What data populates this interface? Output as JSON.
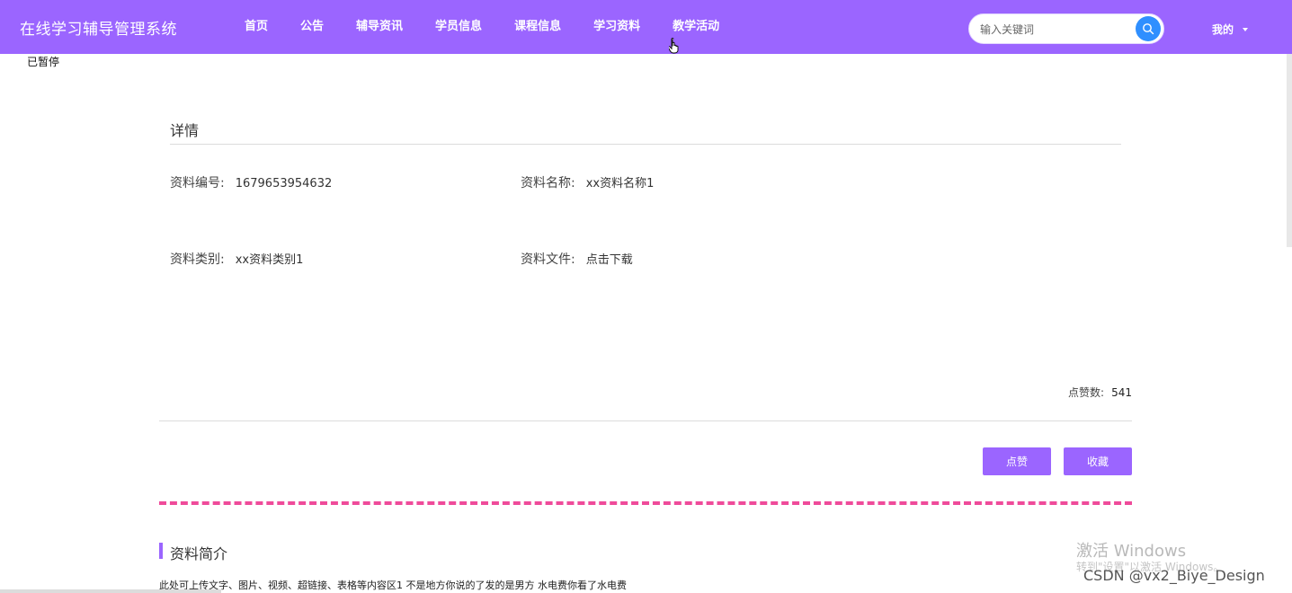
{
  "header": {
    "brand": "在线学习辅导管理系统",
    "nav": [
      "首页",
      "公告",
      "辅导资讯",
      "学员信息",
      "课程信息",
      "学习资料",
      "教学活动"
    ],
    "search_placeholder": "输入关键词",
    "user_menu": "我的"
  },
  "status": {
    "paused": "已暂停"
  },
  "detail": {
    "section_title": "详情",
    "fields": [
      {
        "label": "资料编号:",
        "value": "1679653954632"
      },
      {
        "label": "资料名称:",
        "value": "xx资料名称1"
      },
      {
        "label": "资料类别:",
        "value": "xx资料类别1"
      },
      {
        "label": "资料文件:",
        "value": "点击下载"
      }
    ],
    "likes_label": "点赞数:",
    "likes_value": "541",
    "like_button": "点赞",
    "favorite_button": "收藏"
  },
  "intro": {
    "title": "资料简介",
    "text": "此处可上传文字、图片、视频、超链接、表格等内容区1 不是地方你说的了发的是男方 水电费你看了水电费"
  },
  "watermark": {
    "line1": "激活 Windows",
    "line2": "转到\"设置\"以激活 Windows。",
    "credit": "CSDN @vx2_Biye_Design"
  },
  "colors": {
    "accent": "#9b65ff",
    "search_button": "#2f8fff",
    "dashed_divider": "#ef4b9a"
  }
}
